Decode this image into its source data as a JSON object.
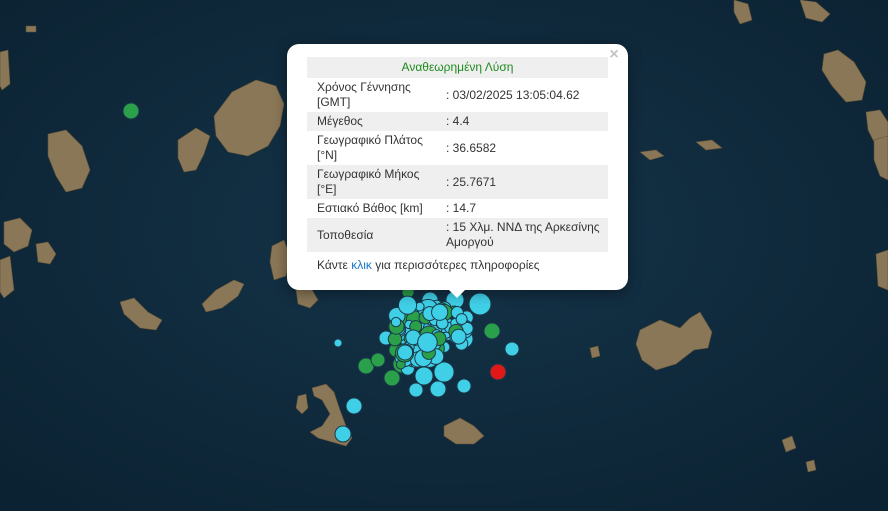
{
  "popup": {
    "title": "Αναθεωρημένη Λύση",
    "rows": [
      {
        "label": "Χρόνος Γέννησης [GMT]",
        "value": ": 03/02/2025 13:05:04.62"
      },
      {
        "label": "Μέγεθος",
        "value": ": 4.4"
      },
      {
        "label": "Γεωγραφικό Πλάτος [°N]",
        "value": ": 36.6582"
      },
      {
        "label": "Γεωγραφικό Μήκος [°E]",
        "value": ": 25.7671"
      },
      {
        "label": "Εστιακό Βάθος [km]",
        "value": ": 14.7"
      },
      {
        "label": "Τοποθεσία",
        "value": ": 15 Χλμ. ΝΝΔ της Αρκεσίνης Αμοργού"
      }
    ],
    "more_prefix": "Κάντε ",
    "more_link": "κλικ",
    "more_suffix": " για περισσότερες πληροφορίες",
    "close_glyph": "×"
  },
  "map": {
    "sea_color": "#102c3f",
    "land_color": "#8d7a5c",
    "marker_colors": {
      "cyan": "#3fd0e8",
      "green": "#2aa04a",
      "red": "#e01818"
    }
  }
}
